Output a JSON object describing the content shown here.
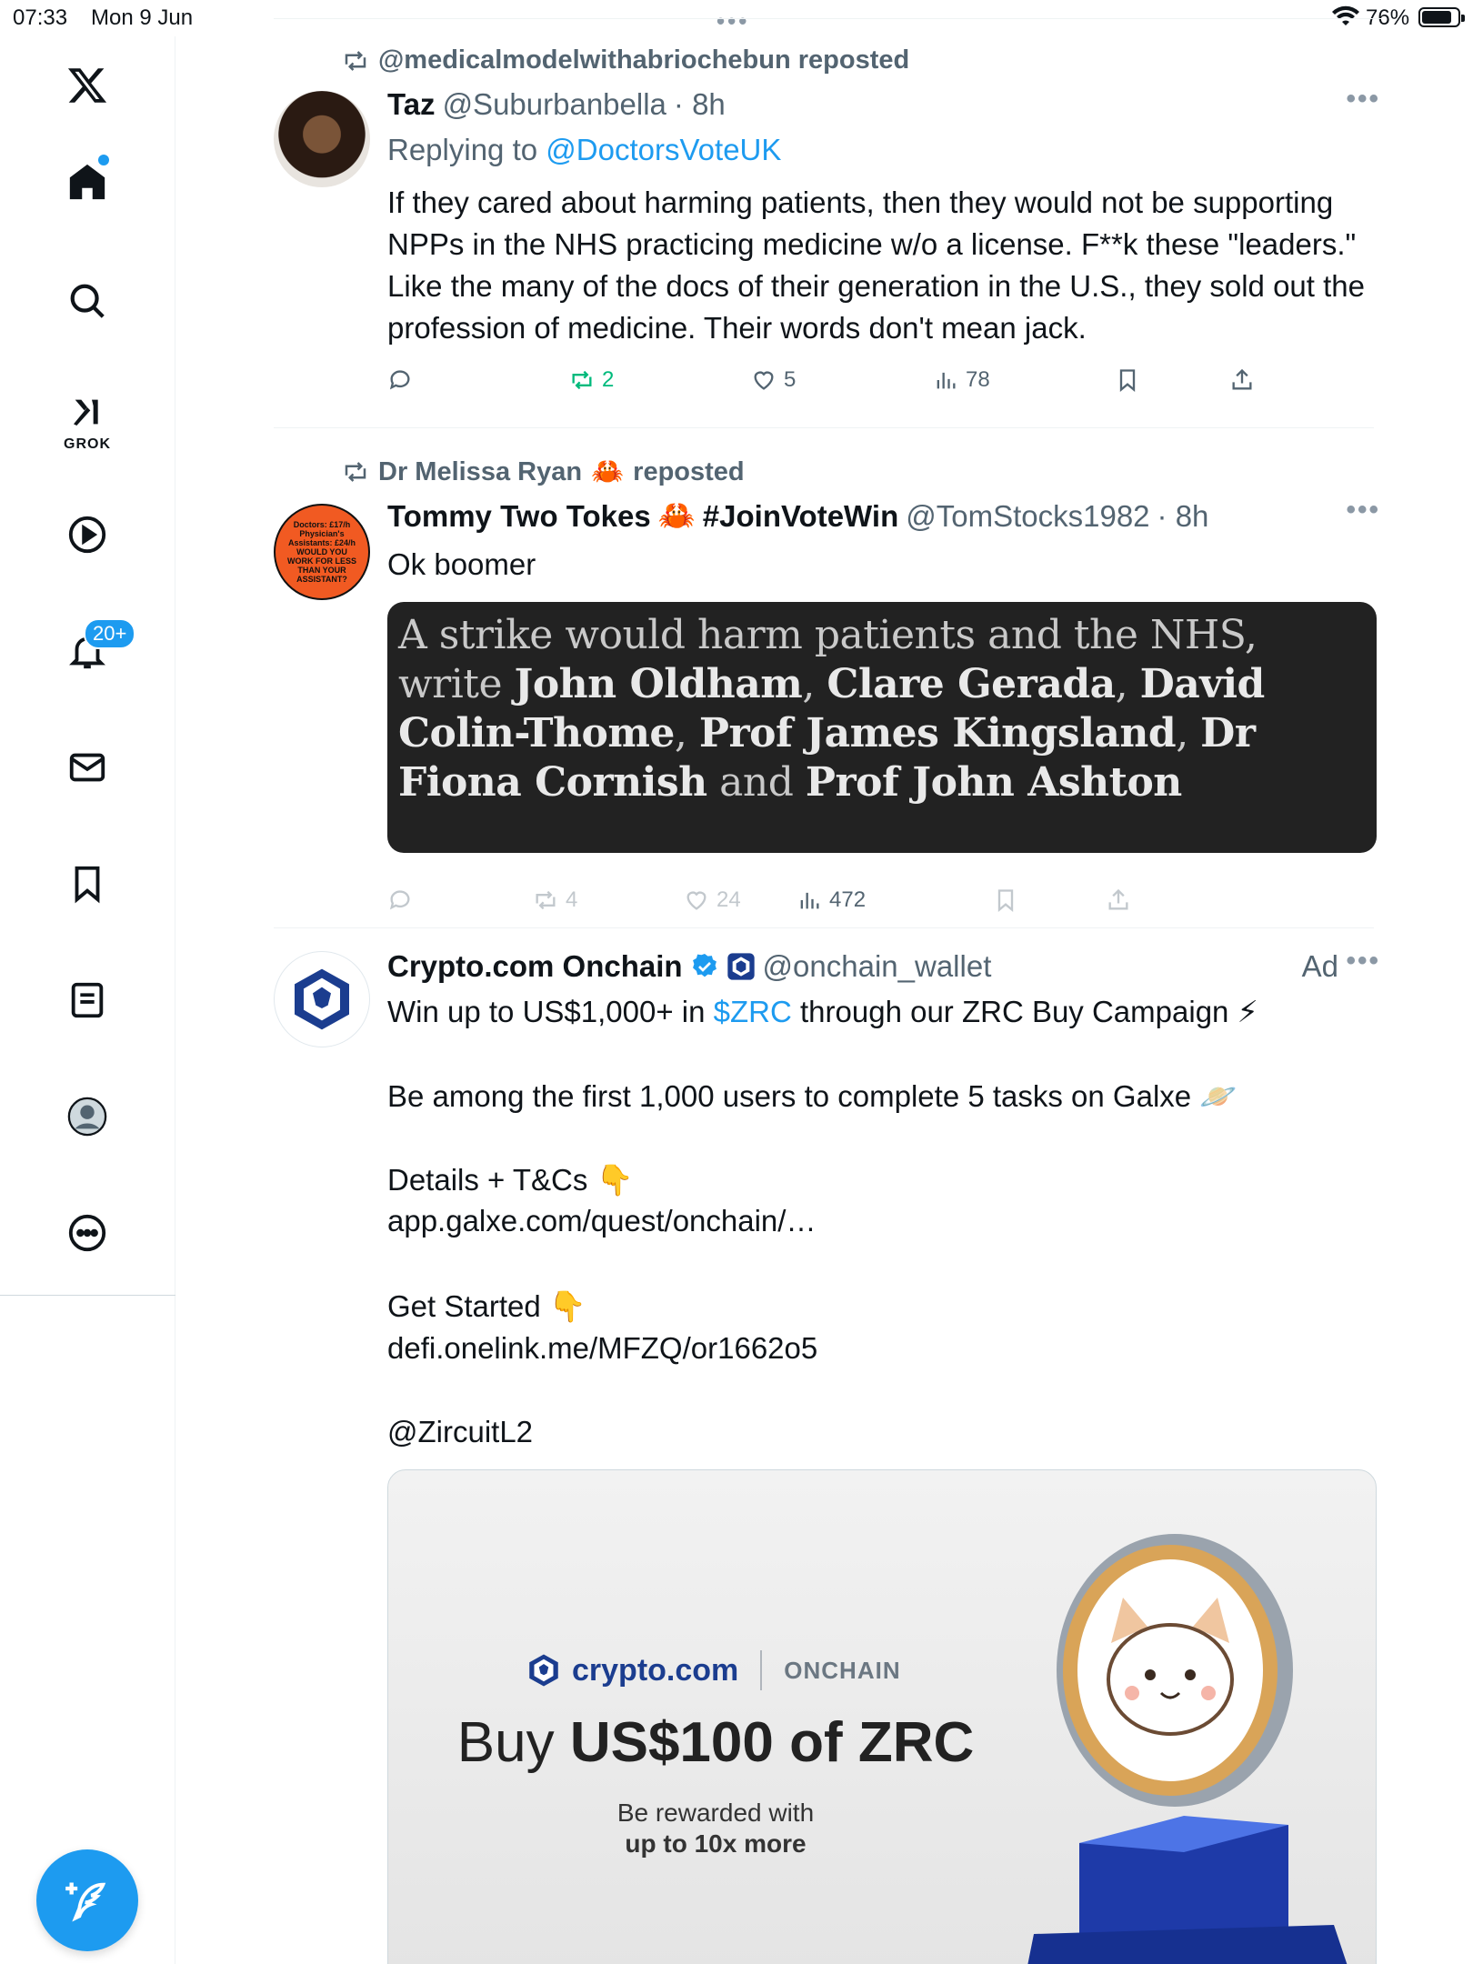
{
  "status_bar": {
    "time": "07:33",
    "date": "Mon 9 Jun",
    "battery": "76%"
  },
  "sidebar": {
    "grok_label": "GROK",
    "notifications_badge": "20+"
  },
  "posts": [
    {
      "repost_by": "@medicalmodelwithabriochebun reposted",
      "name": "Taz",
      "handle": "@Suburbanbella",
      "time": "· 8h",
      "reply_prefix": "Replying to",
      "reply_to": "@DoctorsVoteUK",
      "text": "If they cared about harming patients, then they would not be supporting NPPs in the NHS practicing medicine w/o a license. F**k these \"leaders.\" Like the many of the docs of their generation in the U.S., they sold out the profession of medicine. Their words don't mean jack.",
      "reposts": "2",
      "likes": "5",
      "views": "78"
    },
    {
      "repost_by": "Dr Melissa Ryan",
      "repost_suffix": "reposted",
      "name": "Tommy Two Tokes",
      "name_suffix": "#JoinVoteWin",
      "handle": "@TomStocks1982",
      "time": "· 8h",
      "text": "Ok boomer",
      "avatar_text": "Doctors: £17/h Physician's Assistants: £24/h WOULD YOU WORK FOR LESS THAN YOUR ASSISTANT?",
      "quote_image": {
        "pre": "A strike would harm patients and the NHS, write",
        "names": [
          "John Oldham",
          "Clare Gerada",
          "David Colin-Thome",
          "Prof James Kingsland",
          "Dr Fiona Cornish",
          "Prof John Ashton"
        ],
        "and": "and"
      },
      "reposts": "4",
      "likes": "24",
      "views": "472"
    },
    {
      "name": "Crypto.com Onchain",
      "handle": "@onchain_wallet",
      "ad_label": "Ad",
      "line1_pre": "Win up to US$1,000+ in",
      "line1_cashtag": "$ZRC",
      "line1_post": "through our ZRC Buy Campaign ⚡",
      "line2": "Be among the first 1,000 users to complete 5 tasks on Galxe 🪐",
      "line3": "Details + T&Cs 👇",
      "link1": "app.galxe.com/quest/onchain/…",
      "line4": "Get Started 👇",
      "link2": "defi.onelink.me/MFZQ/or1662o5",
      "mention": "@ZircuitL2",
      "card": {
        "brand": "crypto.com",
        "brand_sub": "ONCHAIN",
        "headline_pre": "Buy",
        "headline_bold": "US$100 of ZRC",
        "sub1": "Be rewarded with",
        "sub2": "up to 10x more"
      }
    }
  ],
  "colors": {
    "accent": "#1d9bf0",
    "repost_green": "#00ba7c",
    "muted": "#536471"
  }
}
